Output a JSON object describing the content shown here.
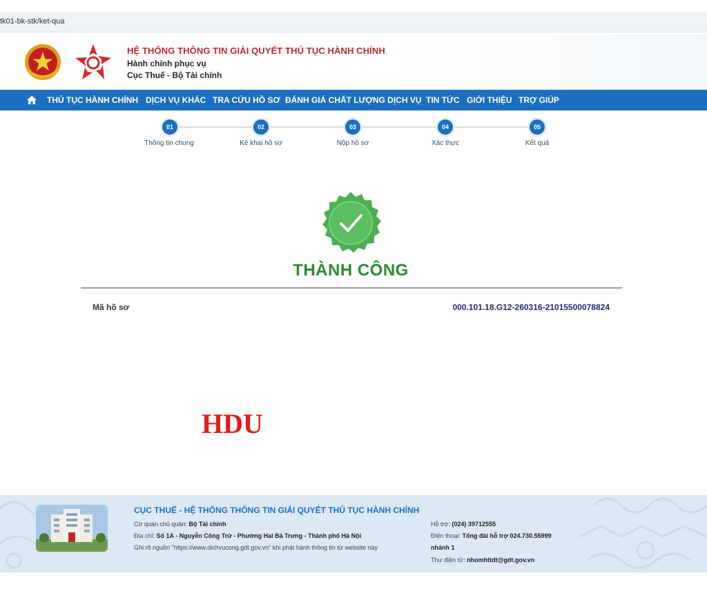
{
  "browser": {
    "url": "tk01-bk-stk/ket-qua"
  },
  "header": {
    "title": "HỆ THỐNG THÔNG TIN GIẢI QUYẾT THỦ TỤC HÀNH CHÍNH",
    "subtitle_1": "Hành chính phục vụ",
    "subtitle_2": "Cục Thuế - Bộ Tài chính"
  },
  "nav": {
    "items": [
      "THỦ TỤC HÀNH CHÍNH",
      "DỊCH VỤ KHÁC",
      "TRA CỨU HỒ SƠ",
      "ĐÁNH GIÁ CHẤT LƯỢNG DỊCH VỤ",
      "TIN TỨC",
      "GIỚI THIỆU",
      "TRỢ GIÚP"
    ]
  },
  "steps": [
    {
      "num": "01",
      "label": "Thông tin chung"
    },
    {
      "num": "02",
      "label": "Kê khai hồ sơ"
    },
    {
      "num": "03",
      "label": "Nộp hồ sơ"
    },
    {
      "num": "04",
      "label": "Xác thực"
    },
    {
      "num": "05",
      "label": "Kết quả"
    }
  ],
  "result": {
    "status": "THÀNH CÔNG",
    "code_label": "Mã hồ sơ",
    "code_value": "000.101.18.G12-260316-21015500078824"
  },
  "watermark": "HDU",
  "footer": {
    "title": "CỤC THUẾ - HỆ THỐNG THÔNG TIN GIẢI QUYẾT THỦ TỤC HÀNH CHÍNH",
    "agency_label": "Cơ quan chủ quản:",
    "agency_value": "Bộ Tài chính",
    "address_label": "Địa chỉ:",
    "address_value": "Số 1A - Nguyễn Công Trứ - Phường Hai Bà Trưng - Thành phố Hà Nội",
    "source_note": "Ghi rõ nguồn \"https://www.dichvucong.gdt.gov.vn\" khi phát hành thông tin từ website này",
    "support_label": "Hỗ trợ:",
    "support_value": "(024) 39712555",
    "phone_label": "Điện thoại:",
    "phone_value": "Tổng đài hỗ trợ 024.730.55999",
    "phone_value_2": "nhánh 1",
    "email_label": "Thư điện tử:",
    "email_value": "nhomhttdt@gdt.gov.vn"
  },
  "colors": {
    "nav_blue": "#1b6fc0",
    "title_red": "#c0272d",
    "success_green": "#2c8a2f",
    "badge_green": "#4caf50",
    "code_navy": "#1f2c6e",
    "watermark_red": "#e31b1b"
  }
}
